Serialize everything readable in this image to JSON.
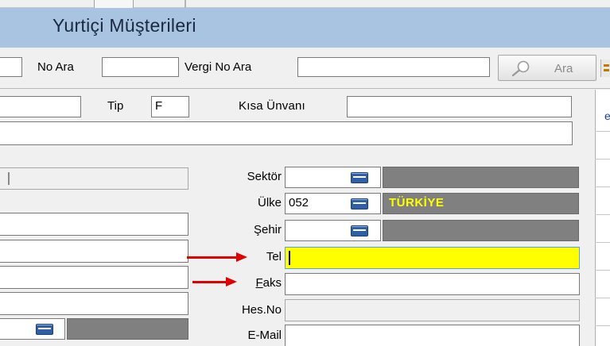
{
  "window": {
    "title": "Yurtiçi Müşterileri"
  },
  "search": {
    "no_label": "No Ara",
    "no_value": "",
    "vergi_label": "Vergi No Ara",
    "vergi_value": "",
    "search_button_label": "Ara"
  },
  "form": {
    "tip_label": "Tip",
    "tip_value": "F",
    "kisa_unvan_label": "Kısa Ünvanı",
    "kisa_unvan_value": "",
    "sektor_label": "Sektör",
    "sektor_value": "",
    "sektor_name": "",
    "ulke_label": "Ülke",
    "ulke_value": "052",
    "ulke_name": "TÜRKİYE",
    "sehir_label": "Şehir",
    "sehir_value": "",
    "sehir_name": "",
    "tel_label": "Tel",
    "tel_value": "",
    "faks_label_rest": "aks",
    "faks_label_accel": "F",
    "faks_value": "",
    "hesno_label": "Hes.No",
    "hesno_value": "",
    "email_label": "E-Mail",
    "email_value": ""
  },
  "colors": {
    "titlebar": "#a9c4e0",
    "highlight_field": "#ffff00",
    "lookup_name_bg": "#808080",
    "lookup_name_text": "#ffff00",
    "arrow": "#e00000"
  },
  "icons": {
    "search": "magnifier-icon",
    "lookup": "lookup-button-icon",
    "annotation": "red-arrow-icon"
  }
}
